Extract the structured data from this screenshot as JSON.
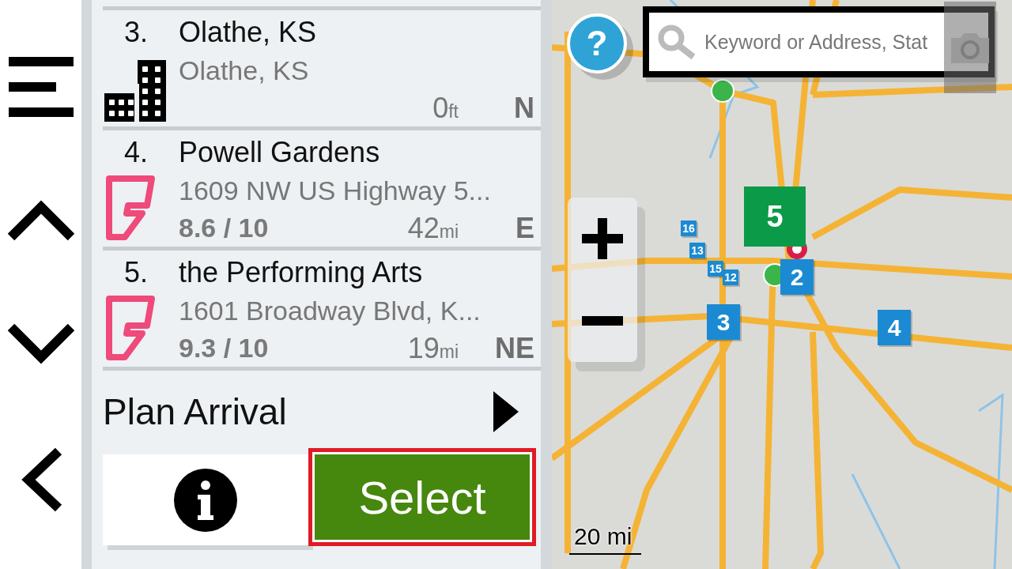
{
  "nav": [
    {
      "kind": "menu"
    },
    {
      "kind": "up"
    },
    {
      "kind": "down"
    },
    {
      "kind": "back"
    }
  ],
  "results": [
    {
      "index": "3.",
      "name": "Olathe, KS",
      "kind": "city",
      "address": "Olathe, KS",
      "distance": "0",
      "unit": "ft",
      "direction": "N"
    },
    {
      "index": "4.",
      "name": "Powell Gardens",
      "kind": "foursquare",
      "address": "1609 NW US Highway 5...",
      "rating": "8.6 / 10",
      "distance": "42",
      "unit": "mi",
      "direction": "E"
    },
    {
      "index": "5.",
      "name": "the Performing Arts",
      "kind": "foursquare",
      "address": "1601 Broadway Blvd, K...",
      "rating": "9.3 / 10",
      "distance": "19",
      "unit": "mi",
      "direction": "NE"
    }
  ],
  "plan_arrival": {
    "label": "Plan Arrival"
  },
  "actions": {
    "select": {
      "label": "Select",
      "focused": true
    }
  },
  "map": {
    "help": "?",
    "search": {
      "placeholder": "Keyword or Address, Stat"
    },
    "markers": [
      {
        "label": "16",
        "kind": "small"
      },
      {
        "label": "13",
        "kind": "small"
      },
      {
        "label": "15",
        "kind": "small"
      },
      {
        "label": "12",
        "kind": "small"
      },
      {
        "label": "3",
        "kind": "square"
      },
      {
        "label": "4",
        "kind": "square"
      },
      {
        "label": "2",
        "kind": "square"
      },
      {
        "label": "5",
        "kind": "flag"
      }
    ],
    "scale": "20 mi"
  }
}
